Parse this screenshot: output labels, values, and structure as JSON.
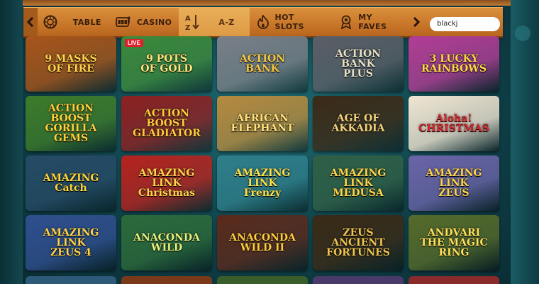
{
  "nav": {
    "tabs": [
      {
        "label": "TABLE",
        "icon": "chip-icon",
        "active": false
      },
      {
        "label": "CASINO",
        "icon": "slot-machine-icon",
        "active": false
      },
      {
        "label": "A-Z",
        "icon": "sort-az-icon",
        "active": true
      },
      {
        "label": "HOT SLOTS",
        "icon": "flame-icon",
        "active": false
      },
      {
        "label": "MY FAVES",
        "icon": "medal-icon",
        "active": false
      }
    ],
    "search_value": "blackj"
  },
  "games": [
    {
      "title": "9 MASKS\nOF FIRE",
      "live": false,
      "bg": "#a8551a",
      "color": "#ffd34a"
    },
    {
      "title": "9 POTS\nOF GOLD",
      "live": true,
      "live_label": "LIVE",
      "bg": "#3c8a3c",
      "color": "#ffe27a"
    },
    {
      "title": "ACTION\nBANK",
      "live": false,
      "bg": "#7a7f87",
      "color": "#f5c842"
    },
    {
      "title": "ACTION BANK\nPLUS",
      "live": false,
      "bg": "#5b5e66",
      "color": "#e8e2c8"
    },
    {
      "title": "3 LUCKY\nRAINBOWS",
      "live": false,
      "bg": "#b23d95",
      "color": "#ffd84a"
    },
    {
      "title": "ACTION BOOST\nGORILLA\nGEMS",
      "live": false,
      "bg": "#3d7b2a",
      "color": "#ffd03a"
    },
    {
      "title": "ACTION BOOST\nGLADIATOR",
      "live": false,
      "bg": "#8d2122",
      "color": "#ffcc3a"
    },
    {
      "title": "AFRICAN\nELEPHANT",
      "live": false,
      "bg": "#b58a3e",
      "color": "#ffe07a"
    },
    {
      "title": "AGE OF\nAKKADIA",
      "live": false,
      "bg": "#3c2a17",
      "color": "#f3d27a"
    },
    {
      "title": "Aloha!\nCHRISTMAS",
      "live": false,
      "bg": "#f0e5d2",
      "color": "#d8262c"
    },
    {
      "title": "AMAZING\nCatch",
      "live": false,
      "bg": "#264b66",
      "color": "#ffd43a"
    },
    {
      "title": "AMAZING\nLINK\nChristmas",
      "live": false,
      "bg": "#b6231e",
      "color": "#ffd34a"
    },
    {
      "title": "AMAZING\nLINK\nFrenzy",
      "live": false,
      "bg": "#2e7e8a",
      "color": "#ffe14a"
    },
    {
      "title": "AMAZING\nLINK\nMEDUSA",
      "live": false,
      "bg": "#2f5f45",
      "color": "#ffd34a"
    },
    {
      "title": "AMAZING\nLINK\nZEUS",
      "live": false,
      "bg": "#6a64a8",
      "color": "#ffd34a"
    },
    {
      "title": "AMAZING\nLINK\nZEUS 4",
      "live": false,
      "bg": "#2f4f8e",
      "color": "#ffd34a"
    },
    {
      "title": "ANACONDA\nWILD",
      "live": false,
      "bg": "#2c6a3a",
      "color": "#e7f07a"
    },
    {
      "title": "ANACONDA\nWILD II",
      "live": false,
      "bg": "#5a2a1c",
      "color": "#ffcc3a"
    },
    {
      "title": "ZEUS\nANCIENT FORTUNES",
      "live": false,
      "bg": "#3a2a16",
      "color": "#f0c550"
    },
    {
      "title": "ANDVARI\nTHE MAGIC RING",
      "live": false,
      "bg": "#556a2a",
      "color": "#ffe05a"
    }
  ],
  "next_row": [
    {
      "bg": "#2c5a78"
    },
    {
      "bg": "#7a3a1a"
    },
    {
      "bg": "#3a5e2a"
    },
    {
      "bg": "#4a3a6a"
    },
    {
      "bg": "#8a2a2a"
    }
  ]
}
